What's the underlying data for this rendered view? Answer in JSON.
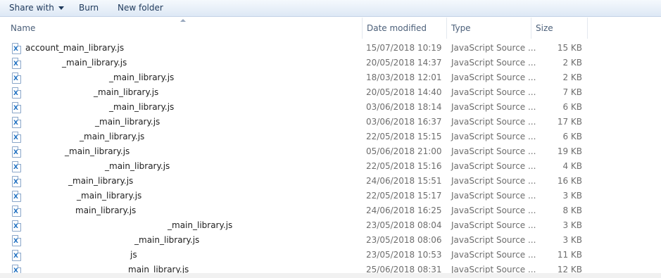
{
  "toolbar": {
    "share_label": "Share with",
    "burn_label": "Burn",
    "new_folder_label": "New folder"
  },
  "columns": {
    "name": "Name",
    "date": "Date modified",
    "type": "Type",
    "size": "Size"
  },
  "files": [
    {
      "name": "account_main_library.js",
      "date": "15/07/2018 10:19",
      "type": "JavaScript Source ...",
      "size": "15 KB"
    },
    {
      "name": "_main_library.js",
      "date": "20/05/2018 14:37",
      "type": "JavaScript Source ...",
      "size": "2 KB"
    },
    {
      "name": "_main_library.js",
      "date": "18/03/2018 12:01",
      "type": "JavaScript Source ...",
      "size": "2 KB"
    },
    {
      "name": "_main_library.js",
      "date": "20/05/2018 14:40",
      "type": "JavaScript Source ...",
      "size": "7 KB"
    },
    {
      "name": "_main_library.js",
      "date": "03/06/2018 18:14",
      "type": "JavaScript Source ...",
      "size": "6 KB"
    },
    {
      "name": "_main_library.js",
      "date": "03/06/2018 16:37",
      "type": "JavaScript Source ...",
      "size": "17 KB"
    },
    {
      "name": "_main_library.js",
      "date": "22/05/2018 15:15",
      "type": "JavaScript Source ...",
      "size": "6 KB"
    },
    {
      "name": "_main_library.js",
      "date": "05/06/2018 21:00",
      "type": "JavaScript Source ...",
      "size": "19 KB"
    },
    {
      "name": "_main_library.js",
      "date": "22/05/2018 15:16",
      "type": "JavaScript Source ...",
      "size": "4 KB"
    },
    {
      "name": "_main_library.js",
      "date": "24/06/2018 15:51",
      "type": "JavaScript Source ...",
      "size": "16 KB"
    },
    {
      "name": "_main_library.js",
      "date": "22/05/2018 15:17",
      "type": "JavaScript Source ...",
      "size": "3 KB"
    },
    {
      "name": "main_library.js",
      "date": "24/06/2018 16:25",
      "type": "JavaScript Source ...",
      "size": "8 KB"
    },
    {
      "name": "_main_library.js",
      "date": "23/05/2018 08:04",
      "type": "JavaScript Source ...",
      "size": "3 KB"
    },
    {
      "name": "_main_library.js",
      "date": "23/05/2018 08:06",
      "type": "JavaScript Source ...",
      "size": "3 KB"
    },
    {
      "name": "js",
      "date": "23/05/2018 10:53",
      "type": "JavaScript Source ...",
      "size": "11 KB"
    },
    {
      "name": "main_library.js",
      "date": "25/06/2018 08:31",
      "type": "JavaScript Source ...",
      "size": "12 KB"
    }
  ],
  "icons": {
    "file_icon": "javascript-file-icon"
  }
}
